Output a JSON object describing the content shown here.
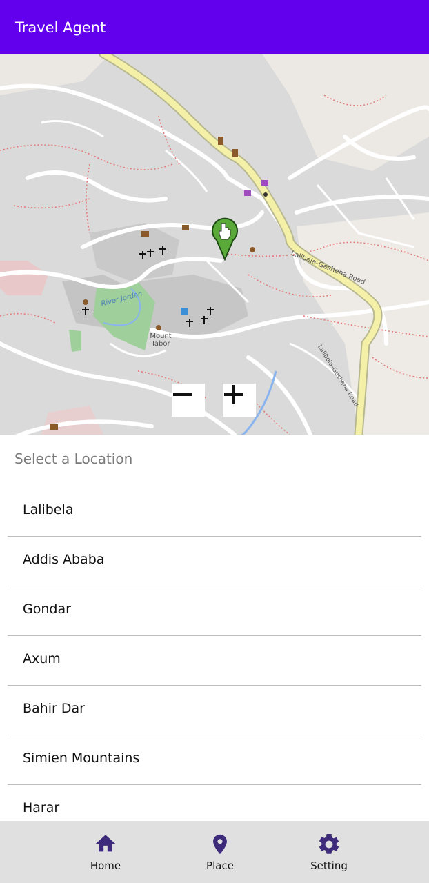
{
  "appbar": {
    "title": "Travel Agent"
  },
  "map": {
    "labels": {
      "river": "River Jordan",
      "mount": "Mount Tabor",
      "road_main": "Lalibela-Geshena Road",
      "road_side": "Lalibela-Geshena Road"
    },
    "zoom_out_icon": "minus-icon",
    "zoom_in_icon": "plus-icon",
    "marker_icon": "map-marker-icon"
  },
  "select": {
    "title": "Select a Location",
    "items": [
      "Lalibela",
      "Addis Ababa",
      "Gondar",
      "Axum",
      "Bahir Dar",
      "Simien Mountains",
      "Harar"
    ]
  },
  "nav": {
    "items": [
      {
        "label": "Home",
        "icon": "home-icon"
      },
      {
        "label": "Place",
        "icon": "place-icon"
      },
      {
        "label": "Setting",
        "icon": "gear-icon"
      }
    ]
  },
  "colors": {
    "appbar": "#6200ee",
    "nav_icon": "#3d2a7a",
    "bottom_nav": "#e0e0e0",
    "marker": "#5aaa3a"
  }
}
